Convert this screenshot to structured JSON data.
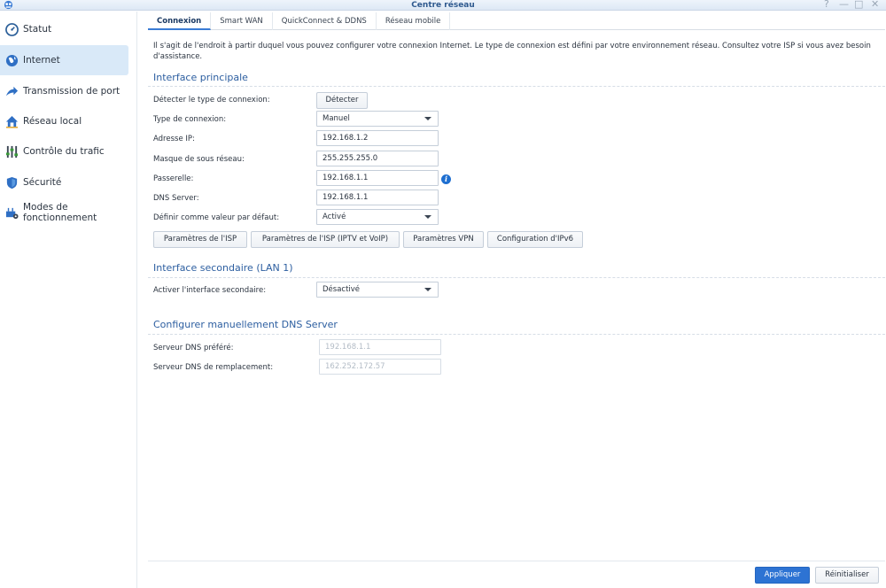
{
  "window": {
    "title": "Centre réseau",
    "help": "?",
    "minimize": "—",
    "maximize": "□",
    "close": "✕"
  },
  "sidebar": {
    "items": [
      {
        "label": "Statut",
        "icon": "status-icon"
      },
      {
        "label": "Internet",
        "icon": "globe-icon",
        "active": true
      },
      {
        "label": "Transmission de port",
        "icon": "arrow-icon"
      },
      {
        "label": "Réseau local",
        "icon": "home-icon"
      },
      {
        "label": "Contrôle du trafic",
        "icon": "traffic-icon"
      },
      {
        "label": "Sécurité",
        "icon": "shield-icon"
      },
      {
        "label": "Modes de fonctionnement",
        "icon": "modes-icon"
      }
    ]
  },
  "tabs": [
    "Connexion",
    "Smart WAN",
    "QuickConnect & DDNS",
    "Réseau mobile"
  ],
  "description": "Il s'agit de l'endroit à partir duquel vous pouvez configurer votre connexion Internet. Le type de connexion est défini par votre environnement réseau. Consultez votre ISP si vous avez besoin d'assistance.",
  "primary": {
    "title": "Interface principale",
    "detect_label": "Détecter le type de connexion:",
    "detect_button": "Détecter",
    "conn_type_label": "Type de connexion:",
    "conn_type_value": "Manuel",
    "ip_label": "Adresse IP:",
    "ip_value": "192.168.1.2",
    "mask_label": "Masque de sous réseau:",
    "mask_value": "255.255.255.0",
    "gateway_label": "Passerelle:",
    "gateway_value": "192.168.1.1",
    "dns_label": "DNS Server:",
    "dns_value": "192.168.1.1",
    "default_label": "Définir comme valeur par défaut:",
    "default_value": "Activé",
    "buttons": [
      "Paramètres de l'ISP",
      "Paramètres de l'ISP (IPTV et VoIP)",
      "Paramètres VPN",
      "Configuration d'IPv6"
    ]
  },
  "secondary": {
    "title": "Interface secondaire (LAN 1)",
    "enable_label": "Activer l'interface secondaire:",
    "enable_value": "Désactivé"
  },
  "dns_manual": {
    "title": "Configurer manuellement DNS Server",
    "preferred_label": "Serveur DNS préféré:",
    "preferred_value": "192.168.1.1",
    "alternate_label": "Serveur DNS de remplacement:",
    "alternate_value": "162.252.172.57"
  },
  "footer": {
    "apply": "Appliquer",
    "reset": "Réinitialiser"
  },
  "colors": {
    "accent": "#2d73d3",
    "sidebar_active": "#d9e9f8",
    "section_title": "#2c5ea0"
  }
}
